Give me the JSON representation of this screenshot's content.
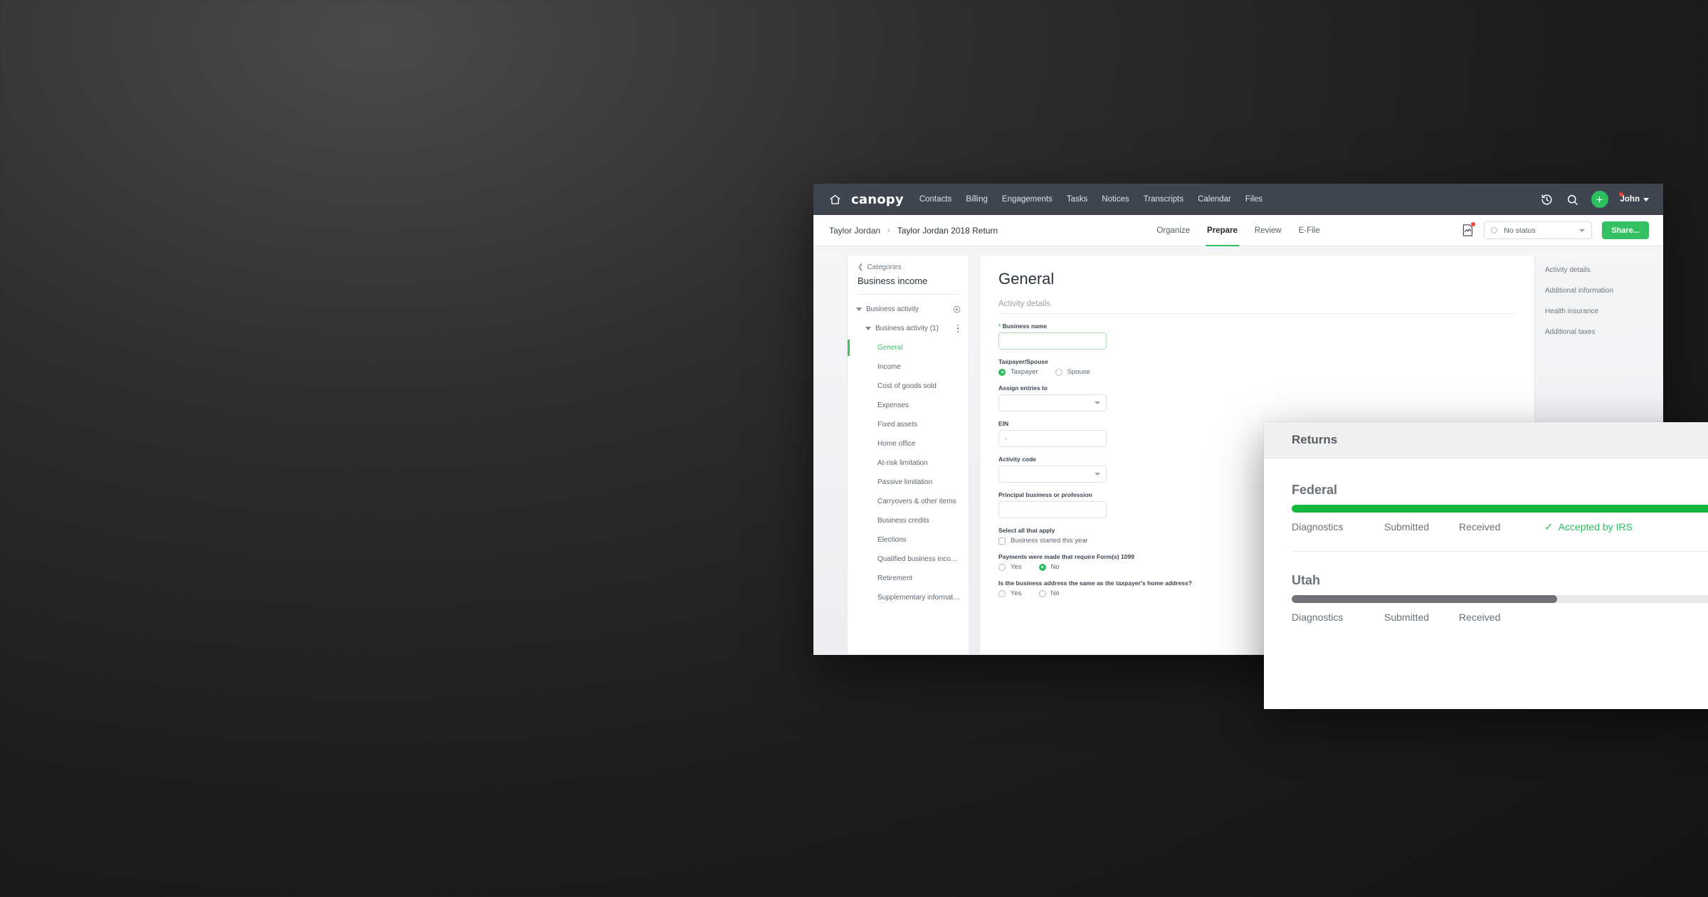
{
  "topnav": {
    "home_icon": "home-icon",
    "brand": "canopy",
    "links": [
      "Contacts",
      "Billing",
      "Engagements",
      "Tasks",
      "Notices",
      "Transcripts",
      "Calendar",
      "Files"
    ],
    "history_icon": "history-clock-icon",
    "search_icon": "search-icon",
    "add_label": "+",
    "user_name": "John",
    "bar_color": "#3e4550"
  },
  "subheader": {
    "breadcrumb_root": "Taylor Jordan",
    "breadcrumb_sep": "›",
    "breadcrumb_current": "Taylor Jordan 2018 Return",
    "phases": [
      {
        "label": "Organize",
        "active": false
      },
      {
        "label": "Prepare",
        "active": true
      },
      {
        "label": "Review",
        "active": false
      },
      {
        "label": "E-File",
        "active": false
      }
    ],
    "doc_alert_icon": "document-alert-icon",
    "status_value": "No status",
    "share_label": "Share...",
    "accent_color": "#2dbe60",
    "share_color": "#34c060"
  },
  "sidebar": {
    "back_label": "Categories",
    "back_icon": "chevron-left-icon",
    "title": "Business income",
    "tree": [
      {
        "label": "Business activity",
        "depth": 1,
        "expanded": true,
        "selected": false,
        "action": "add-circle-icon"
      },
      {
        "label": "Business activity (1)",
        "depth": 2,
        "expanded": true,
        "selected": false,
        "action": "kebab-menu-icon"
      },
      {
        "label": "General",
        "depth": 3,
        "expanded": false,
        "selected": true,
        "action": ""
      },
      {
        "label": "Income",
        "depth": 3,
        "expanded": false,
        "selected": false,
        "action": ""
      },
      {
        "label": "Cost of goods sold",
        "depth": 3,
        "expanded": false,
        "selected": false,
        "action": ""
      },
      {
        "label": "Expenses",
        "depth": 3,
        "expanded": false,
        "selected": false,
        "action": ""
      },
      {
        "label": "Fixed assets",
        "depth": 3,
        "expanded": false,
        "selected": false,
        "action": ""
      },
      {
        "label": "Home office",
        "depth": 3,
        "expanded": false,
        "selected": false,
        "action": ""
      },
      {
        "label": "At-risk limitation",
        "depth": 3,
        "expanded": false,
        "selected": false,
        "action": ""
      },
      {
        "label": "Passive limitation",
        "depth": 3,
        "expanded": false,
        "selected": false,
        "action": ""
      },
      {
        "label": "Carryovers & other items",
        "depth": 3,
        "expanded": false,
        "selected": false,
        "action": ""
      },
      {
        "label": "Business credits",
        "depth": 3,
        "expanded": false,
        "selected": false,
        "action": ""
      },
      {
        "label": "Elections",
        "depth": 3,
        "expanded": false,
        "selected": false,
        "action": ""
      },
      {
        "label": "Qualified business income ded…",
        "depth": 3,
        "expanded": false,
        "selected": false,
        "action": ""
      },
      {
        "label": "Retirement",
        "depth": 3,
        "expanded": false,
        "selected": false,
        "action": ""
      },
      {
        "label": "Supplementary information",
        "depth": 3,
        "expanded": false,
        "selected": false,
        "action": ""
      }
    ]
  },
  "form": {
    "title": "General",
    "section_label": "Activity details",
    "business_name": {
      "label": "Business name",
      "required": true,
      "value": "",
      "placeholder": ""
    },
    "taxpayer_spouse": {
      "label": "Taxpayer/Spouse",
      "options": [
        {
          "label": "Taxpayer",
          "selected": true
        },
        {
          "label": "Spouse",
          "selected": false
        }
      ]
    },
    "assign_entries": {
      "label": "Assign entries to",
      "value": ""
    },
    "ein": {
      "label": "EIN",
      "value": "",
      "placeholder": "-"
    },
    "activity_code": {
      "label": "Activity code",
      "value": ""
    },
    "principal_business": {
      "label": "Principal business or profession",
      "value": ""
    },
    "select_all": {
      "label": "Select all that apply",
      "options": [
        {
          "label": "Business started this year",
          "checked": false
        }
      ]
    },
    "payments_1099": {
      "label": "Payments were made that require Form(s) 1099",
      "options": [
        {
          "label": "Yes",
          "selected": false
        },
        {
          "label": "No",
          "selected": true
        }
      ]
    },
    "business_address": {
      "label": "Is the business address the same as the taxpayer's home address?",
      "options": [
        {
          "label": "Yes",
          "selected": false
        },
        {
          "label": "No",
          "selected": false
        }
      ]
    }
  },
  "section_nav": {
    "items": [
      "Activity details",
      "Additional information",
      "Health insurance",
      "Additional taxes"
    ]
  },
  "returns_panel": {
    "title": "Returns",
    "returns": [
      {
        "name": "Federal",
        "progress_percent": 100,
        "bar_color": "#14b83d",
        "steps": [
          "Diagnostics",
          "Submitted",
          "Received"
        ],
        "final_status": "Accepted by IRS",
        "final_status_icon": "check-icon",
        "final_status_color": "#2dbe60"
      },
      {
        "name": "Utah",
        "progress_percent": 61,
        "bar_color": "#6f7276",
        "steps": [
          "Diagnostics",
          "Submitted",
          "Received"
        ],
        "final_status": "",
        "final_status_icon": "",
        "final_status_color": ""
      }
    ]
  }
}
